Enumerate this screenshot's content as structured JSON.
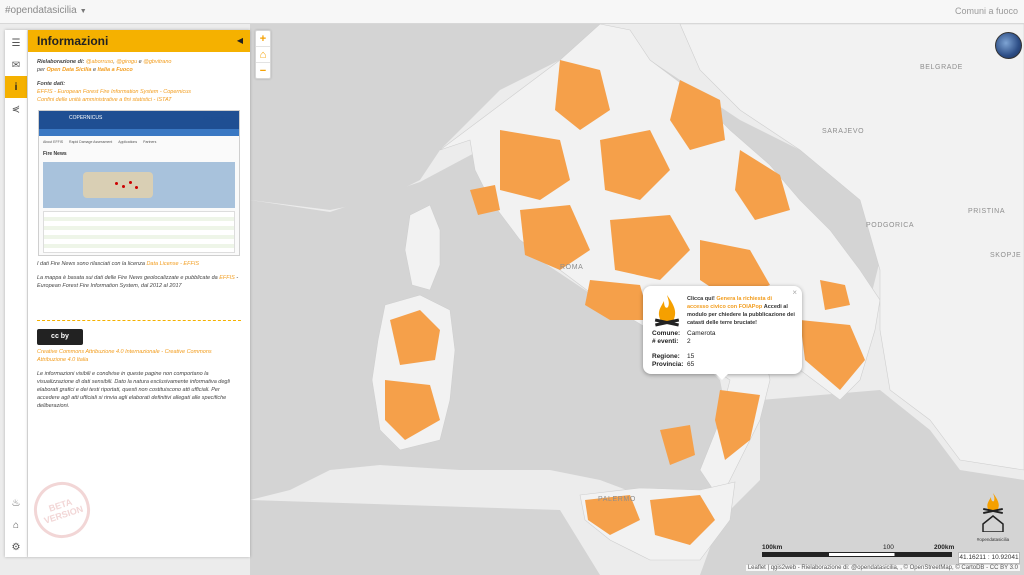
{
  "topbar": {
    "brand": "#opendatasicilia",
    "right_link": "Comuni a fuoco"
  },
  "sidebar": {
    "tabs": [
      "menu-icon",
      "mail-icon",
      "info-icon",
      "share-icon"
    ],
    "bottom_tabs": [
      "fire-icon",
      "burnt-house-icon",
      "gear-icon"
    ]
  },
  "panel": {
    "title": "Informazioni",
    "elab_prefix": "Rielaborazione di:",
    "authors": [
      "@aborruso",
      "@girogu",
      "@gbvitrano"
    ],
    "sep_comma": ",",
    "sep_and": "e",
    "per": "per",
    "org1": "Open Data Sicilia",
    "org2": "Italia a Fuoco",
    "sources_title": "Fonte dati:",
    "source1": "EFFIS - European Forest Fire Information System - Copernicus",
    "source2": "Confini delle unità amministrative a fini statistici - ISTAT",
    "thumb_header": "COPERNICUS",
    "thumb_brand": "Copernicus",
    "thumb_section": "Fire News",
    "thumb_nav": [
      "About EFFIS",
      "Rapid Damage Assessment",
      "Applications",
      "Partners"
    ],
    "license_text": "I dati Fire News sono rilasciati con la licenza",
    "license_link": "Data License - EFFIS",
    "map_based": "La mappa è basata sui dati delle Fire News geolocalizzate e pubblicate da",
    "effis_link": "EFFIS",
    "map_based_tail": "- European Forest Fire Information System, dal 2012 al 2017",
    "cc_badge": "cc  by",
    "cc_link": "Creative Commons Attribuzione 4.0 Internazionale - Creative Commons Attribuzione 4.0 Italia",
    "disclaimer": "Le informazioni visibili e condivise in queste pagine non comportano la visualizzazione di dati sensibili. Dato la natura esclusivamente informativa degli elaborati grafici e dei testi riportati, questi non costituiscono atti ufficiali. Per accedere agli atti ufficiali si rinvia agli elaborati definitivi allegati alle specifiche deliberazioni.",
    "beta": "BETA VERSION"
  },
  "zoom": {
    "in": "+",
    "home": "⌂",
    "out": "−"
  },
  "map_labels": {
    "belgrade": "BELGRADE",
    "sarajevo": "SARAJEVO",
    "podgorica": "PODGORICA",
    "pristina": "PRISTINA",
    "skopje": "SKOPJE",
    "palermo": "PALERMO",
    "rome": "ROMA"
  },
  "popup": {
    "intro_1": "Clicca qui!",
    "intro_link": "Genera la richiesta di accesso civico con FOIAPop",
    "intro_2": "Accedi al modulo per chiedere la pubblicazione dei catasti delle terre bruciate!",
    "comune_label": "Comune:",
    "comune_value": "Camerota",
    "eventi_label": "# eventi:",
    "eventi_value": "2",
    "regione_label": "Regione:",
    "regione_value": "15",
    "provincia_label": "Provincia:",
    "provincia_value": "65"
  },
  "scale": {
    "left": "100km",
    "mid": "100",
    "right": "200km"
  },
  "coords": "41.16211 : 10.92041",
  "attribution": "Leaflet | qgis2web - Rielaborazione di: @opendatasicilia, , © OpenStreetMap, © CartoDB - CC BY 3.0",
  "ods_label": "#opendatasicilia",
  "colors": {
    "accent": "#f5b100",
    "burned": "#f5a04a",
    "land": "#ececec",
    "sea": "#d4d4d4"
  }
}
